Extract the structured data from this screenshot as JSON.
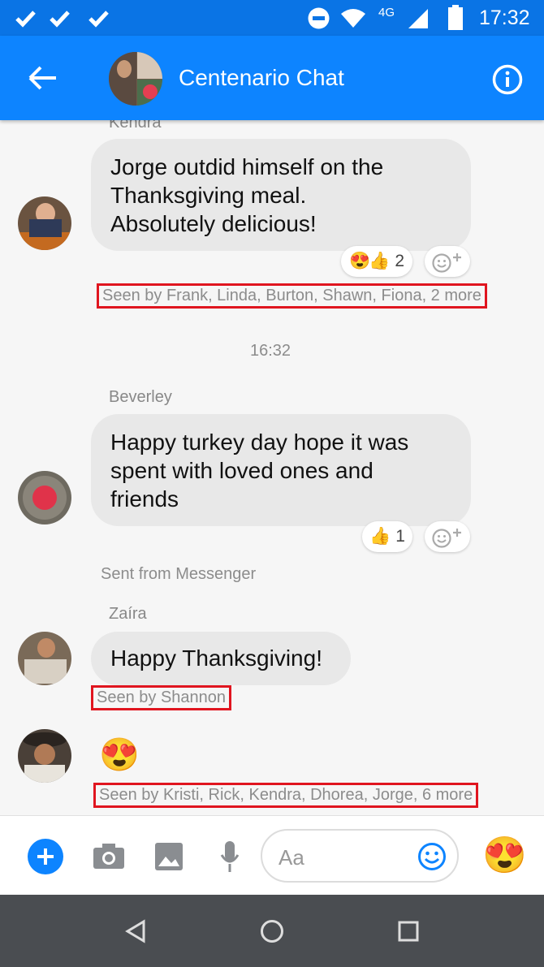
{
  "status": {
    "time": "17:32",
    "network": "4G"
  },
  "header": {
    "title": "Centenario Chat"
  },
  "messages": {
    "m1": {
      "sender": "Kendra",
      "text_lines": [
        "Jorge outdid himself on the",
        "Thanksgiving meal.",
        "Absolutely delicious!"
      ],
      "reaction_count": "2",
      "seen": "Seen by Frank, Linda, Burton, Shawn, Fiona, 2 more"
    },
    "timestamp": "16:32",
    "m2": {
      "sender": "Beverley",
      "text_lines": [
        "Happy turkey day hope it was",
        "spent with loved ones and",
        "friends"
      ],
      "reaction_count": "1",
      "footer": "Sent from Messenger"
    },
    "m3": {
      "sender": "Zaíra",
      "text": "Happy Thanksgiving!",
      "seen": "Seen by Shannon"
    },
    "m4": {
      "emoji": "😍",
      "seen": "Seen by Kristi, Rick, Kendra, Dhorea, Jorge, 6 more"
    }
  },
  "composer": {
    "placeholder": "Aa",
    "like_emoji": "😍"
  },
  "colors": {
    "accent": "#0d84ff",
    "highlight": "#e0151f"
  }
}
